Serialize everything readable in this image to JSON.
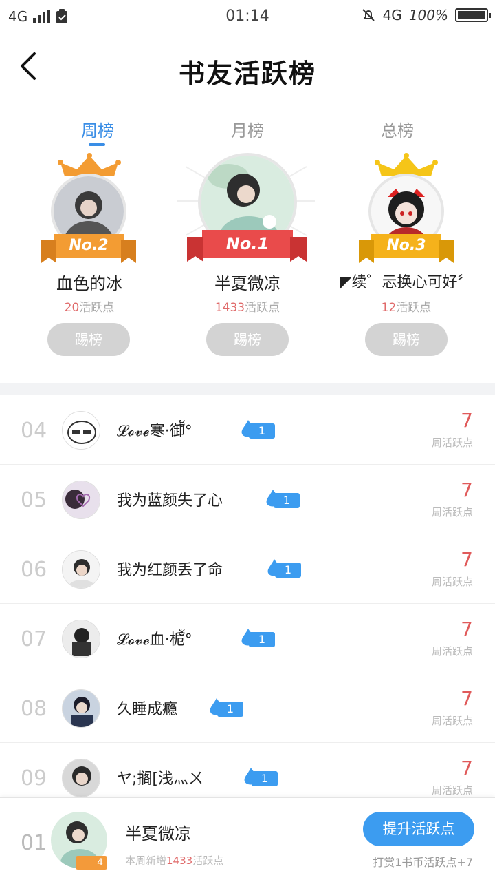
{
  "status_bar": {
    "network_left": "4G",
    "time": "01:14",
    "network_right": "4G",
    "battery": "100%"
  },
  "header": {
    "title": "书友活跃榜",
    "back_icon": "back-arrow-icon"
  },
  "tabs": [
    {
      "label": "周榜",
      "active": true
    },
    {
      "label": "月榜",
      "active": false
    },
    {
      "label": "总榜",
      "active": false
    }
  ],
  "podium": [
    {
      "rank_label": "No.2",
      "name": "血色的冰",
      "score": "20",
      "unit": "活跃点",
      "button": "踢榜",
      "ribbon_color": "#f39c33",
      "crown_color": "#f39c33"
    },
    {
      "rank_label": "No.1",
      "name": "半夏微凉",
      "score": "1433",
      "unit": "活跃点",
      "button": "踢榜",
      "ribbon_color": "#e94b4b"
    },
    {
      "rank_label": "No.3",
      "name": "◤续゜忈换心可好〞",
      "score": "12",
      "unit": "活跃点",
      "button": "踢榜",
      "ribbon_color": "#f5b21b",
      "crown_color": "#f5c518"
    }
  ],
  "list": [
    {
      "rank": "04",
      "name": "𝓛𝓸𝓿𝓮寒·御ัั°",
      "level": "1",
      "score": "7",
      "unit": "周活跃点"
    },
    {
      "rank": "05",
      "name": "我为蓝颜失了心",
      "level": "1",
      "score": "7",
      "unit": "周活跃点"
    },
    {
      "rank": "06",
      "name": "我为红颜丢了命",
      "level": "1",
      "score": "7",
      "unit": "周活跃点"
    },
    {
      "rank": "07",
      "name": "𝓛𝓸𝓿𝓮血·栀ัั°",
      "level": "1",
      "score": "7",
      "unit": "周活跃点"
    },
    {
      "rank": "08",
      "name": "久睡成瘾",
      "level": "1",
      "score": "7",
      "unit": "周活跃点"
    },
    {
      "rank": "09",
      "name": "ヤ;搁[浅灬ㄨ",
      "level": "1",
      "score": "7",
      "unit": "周活跃点"
    }
  ],
  "me": {
    "rank": "01",
    "name": "半夏微凉",
    "level": "4",
    "week_prefix": "本周新增",
    "week_points": "1433",
    "week_suffix": "活跃点",
    "boost_button": "提升活跃点",
    "reward_note": "打赏1书币活跃点+7"
  },
  "colors": {
    "accent": "#3a8ee6",
    "score_red": "#e05a5a"
  }
}
